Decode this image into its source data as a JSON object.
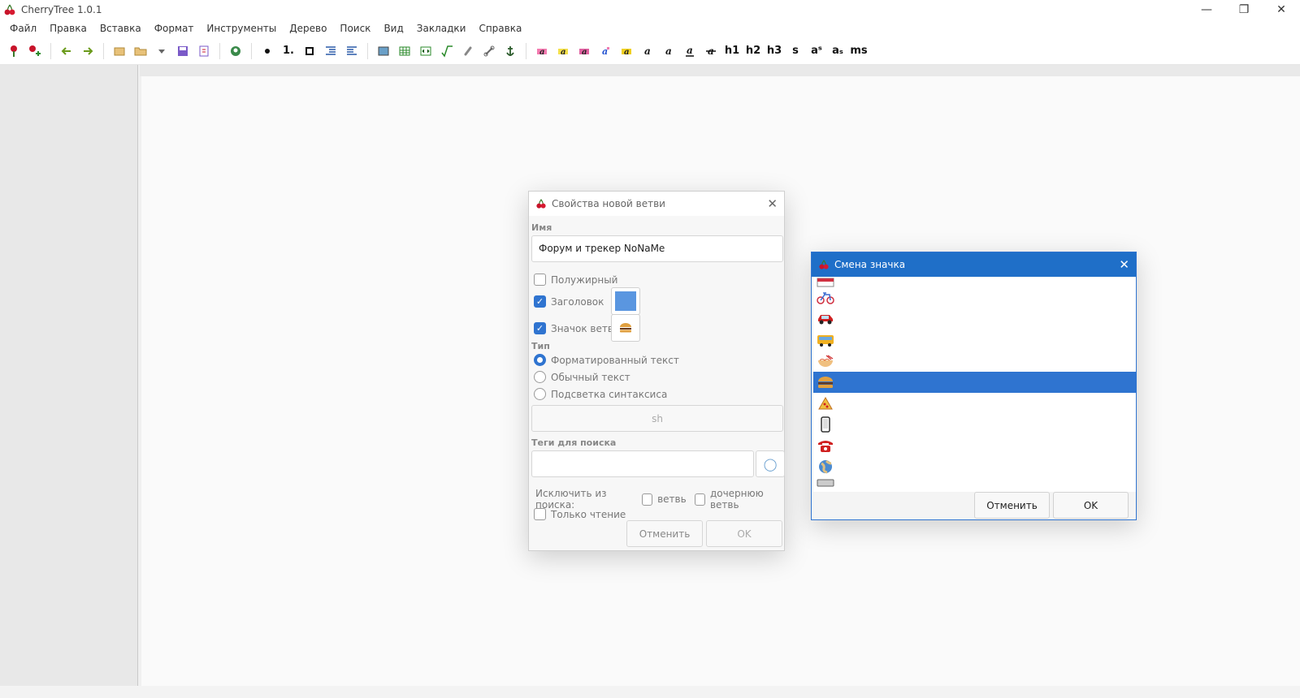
{
  "window": {
    "title": "CherryTree 1.0.1",
    "controls": [
      "—",
      "❐",
      "✕"
    ]
  },
  "menu": [
    "Файл",
    "Правка",
    "Вставка",
    "Формат",
    "Инструменты",
    "Дерево",
    "Поиск",
    "Вид",
    "Закладки",
    "Справка"
  ],
  "toolbar": {
    "text_buttons": [
      "h1",
      "h2",
      "h3",
      "s",
      "aˢ",
      "aₛ",
      "ms"
    ]
  },
  "node_dialog": {
    "title": "Свойства новой ветви",
    "name_label": "Имя",
    "name_value": "Форум и трекер NoNaMe",
    "bold_label": "Полужирный",
    "heading_label": "Заголовок",
    "node_icon_label": "Значок ветви",
    "type_label": "Тип",
    "type_rich": "Форматированный текст",
    "type_plain": "Обычный текст",
    "type_code": "Подсветка синтаксиса",
    "syntax_value": "sh",
    "tags_label": "Теги для поиска",
    "exclude_label": "Исключить из поиска:",
    "exclude_node": "ветвь",
    "exclude_children": "дочернюю ветвь",
    "readonly_label": "Только чтение",
    "cancel": "Отменить",
    "ok": "OK",
    "heading_color": "#5a96e0"
  },
  "icon_dialog": {
    "title": "Смена значка",
    "icons": [
      "calendar",
      "bicycle",
      "car",
      "bus",
      "ramen",
      "burger",
      "pizza",
      "phone",
      "telephone",
      "globe",
      "keyboard"
    ],
    "selected": "burger",
    "cancel": "Отменить",
    "ok": "OK"
  }
}
